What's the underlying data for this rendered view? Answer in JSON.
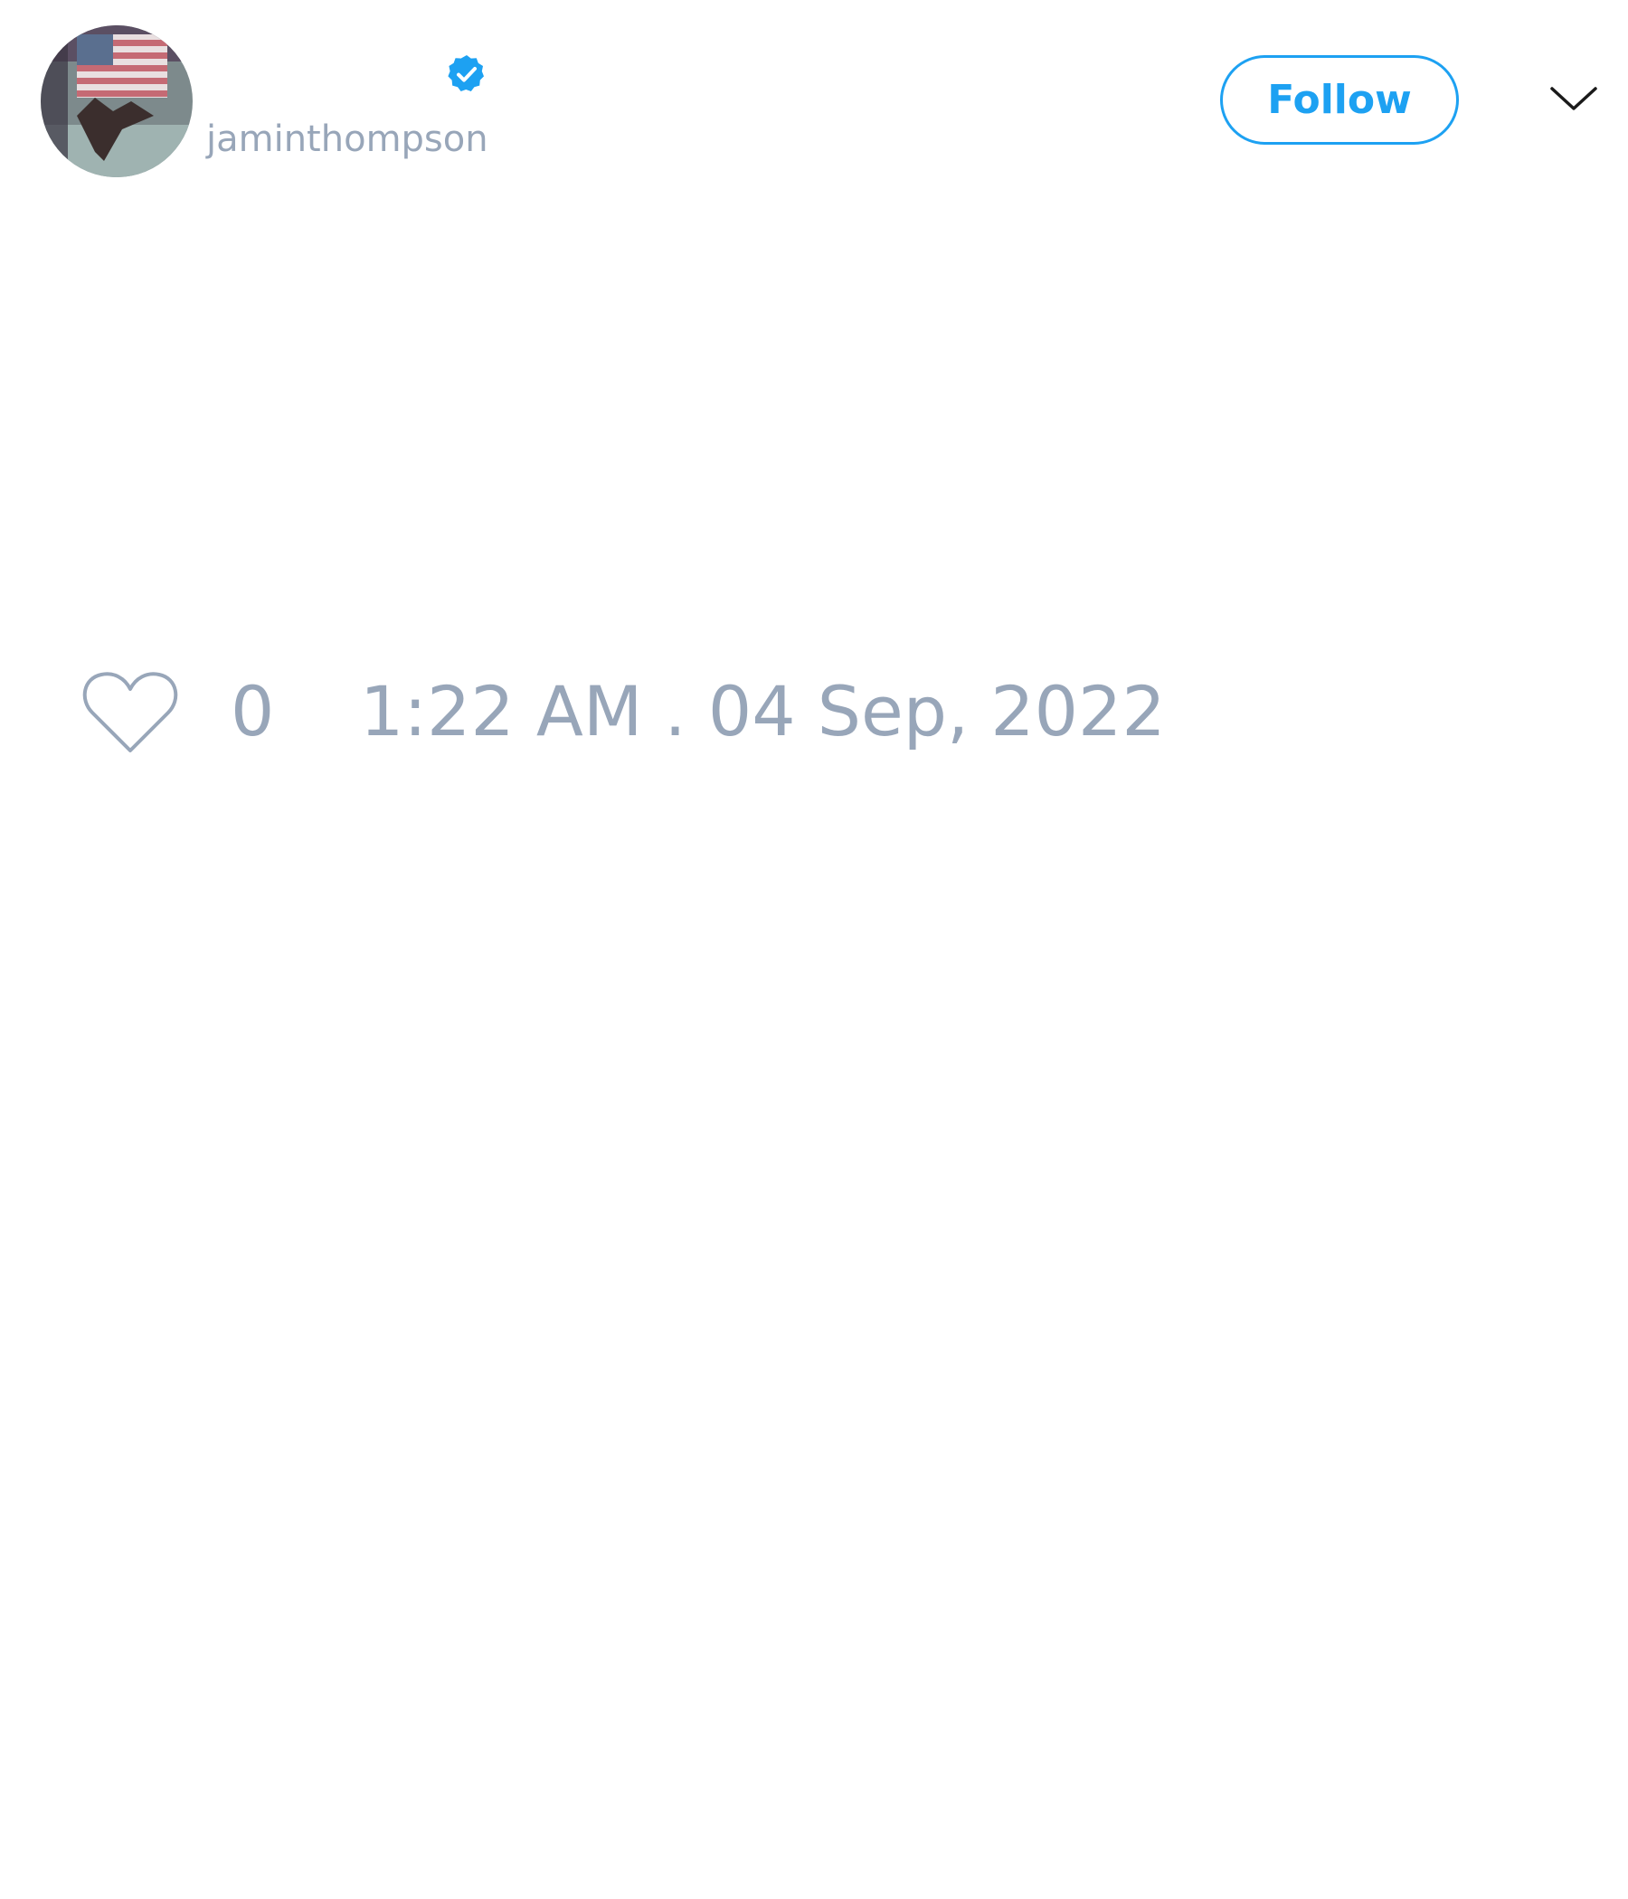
{
  "tweet": {
    "author": {
      "username": "jaminthompson",
      "verified": true,
      "avatar": "profile-photo-flag-icon"
    },
    "actions": {
      "follow_label": "Follow",
      "menu_icon": "chevron-down-icon"
    },
    "stats": {
      "like_icon": "heart-icon",
      "like_count": "0",
      "timestamp": "1:22 AM . 04 Sep, 2022"
    }
  },
  "colors": {
    "accent": "#1da1f2",
    "muted_text": "#98a6b9",
    "background": "#ffffff"
  }
}
